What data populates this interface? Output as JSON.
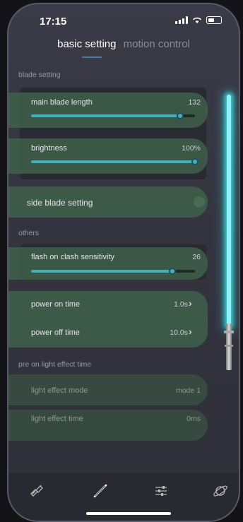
{
  "status": {
    "time": "17:15"
  },
  "tabs": [
    {
      "label": "basic setting",
      "active": true
    },
    {
      "label": "motion control",
      "active": false
    }
  ],
  "sections": {
    "blade_setting": "blade setting",
    "others": "others",
    "pre_on": "pre on light effect time"
  },
  "blade": {
    "main_length": {
      "label": "main blade length",
      "value": "132",
      "fraction": 0.91
    },
    "brightness": {
      "label": "brightness",
      "value": "100%",
      "fraction": 1.0
    }
  },
  "side_blade": {
    "label": "side blade setting",
    "enabled": false
  },
  "others": {
    "clash": {
      "label": "flash on clash sensitivity",
      "value": "26",
      "fraction": 0.86
    },
    "power_on": {
      "label": "power on time",
      "value": "1.0s"
    },
    "power_off": {
      "label": "power off time",
      "value": "10.0s"
    }
  },
  "pre_on": {
    "mode": {
      "label": "light effect mode",
      "value": "mode 1"
    },
    "time": {
      "label": "light effect time",
      "value": "0ms"
    }
  },
  "bottom_nav": [
    {
      "icon": "link-icon"
    },
    {
      "icon": "saber-icon",
      "active": true
    },
    {
      "icon": "sliders-icon"
    },
    {
      "icon": "planet-icon"
    }
  ],
  "colors": {
    "accent": "#3fb0c0",
    "pill": "#40624a",
    "blade": "#8ff3f5"
  }
}
